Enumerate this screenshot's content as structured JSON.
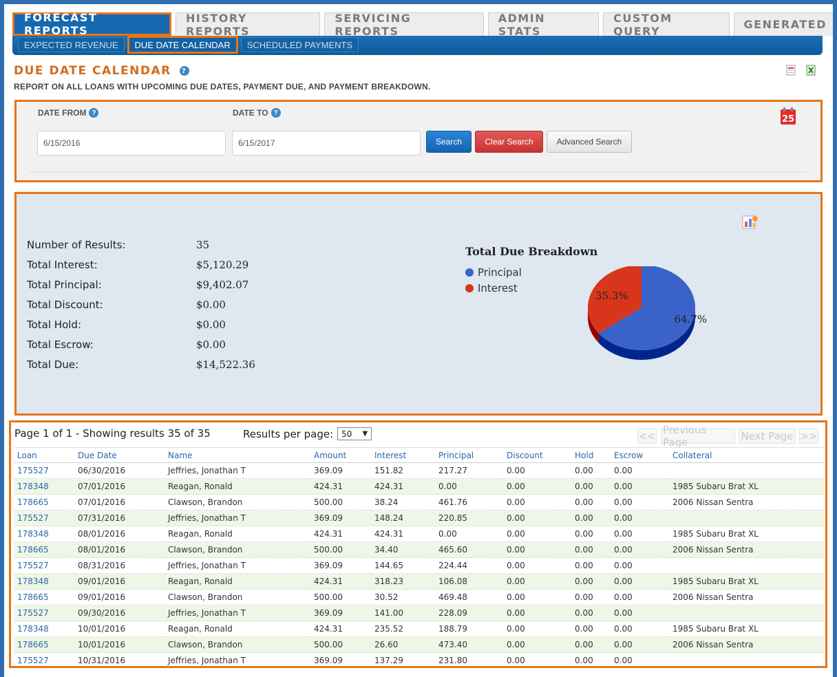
{
  "top_tabs": [
    {
      "label": "FORECAST REPORTS",
      "active": true
    },
    {
      "label": "HISTORY REPORTS",
      "active": false
    },
    {
      "label": "SERVICING REPORTS",
      "active": false
    },
    {
      "label": "ADMIN STATS",
      "active": false
    },
    {
      "label": "CUSTOM QUERY",
      "active": false
    },
    {
      "label": "GENERATED",
      "active": false
    }
  ],
  "sub_tabs": [
    {
      "label": "EXPECTED REVENUE",
      "active": false
    },
    {
      "label": "DUE DATE CALENDAR",
      "active": true
    },
    {
      "label": "SCHEDULED PAYMENTS",
      "active": false
    }
  ],
  "page": {
    "title": "DUE DATE CALENDAR",
    "description": "REPORT ON ALL LOANS WITH UPCOMING DUE DATES, PAYMENT DUE, AND PAYMENT BREAKDOWN."
  },
  "search": {
    "date_from_label": "DATE FROM",
    "date_from_value": "6/15/2016",
    "date_to_label": "DATE TO",
    "date_to_value": "6/15/2017",
    "search_label": "Search",
    "clear_label": "Clear Search",
    "advanced_label": "Advanced Search",
    "calendar_day": "25"
  },
  "summary": {
    "rows": [
      {
        "label": "Number of Results:",
        "value": "35"
      },
      {
        "label": "Total Interest:",
        "value": "$5,120.29"
      },
      {
        "label": "Total Principal:",
        "value": "$9,402.07"
      },
      {
        "label": "Total Discount:",
        "value": "$0.00"
      },
      {
        "label": "Total Hold:",
        "value": "$0.00"
      },
      {
        "label": "Total Escrow:",
        "value": "$0.00"
      },
      {
        "label": "Total Due:",
        "value": "$14,522.36"
      }
    ]
  },
  "chart_data": {
    "type": "pie",
    "title": "Total Due Breakdown",
    "categories": [
      "Principal",
      "Interest"
    ],
    "values": [
      64.7,
      35.3
    ],
    "labels": [
      "64.7%",
      "35.3%"
    ],
    "colors": [
      "#3a62c9",
      "#d8361c"
    ],
    "legend": "top-left"
  },
  "results": {
    "page_info": "Page 1 of 1 - Showing results 35 of 35",
    "per_page_label": "Results per page:",
    "per_page_value": "50",
    "first_label": "<<",
    "prev_label": "Previous Page",
    "next_label": "Next Page",
    "last_label": ">>",
    "columns": [
      "Loan",
      "Due Date",
      "Name",
      "Amount",
      "Interest",
      "Principal",
      "Discount",
      "Hold",
      "Escrow",
      "Collateral"
    ],
    "rows": [
      [
        "175527",
        "06/30/2016",
        "Jeffries, Jonathan T",
        "369.09",
        "151.82",
        "217.27",
        "0.00",
        "0.00",
        "0.00",
        ""
      ],
      [
        "178348",
        "07/01/2016",
        "Reagan, Ronald",
        "424.31",
        "424.31",
        "0.00",
        "0.00",
        "0.00",
        "0.00",
        "1985 Subaru Brat XL"
      ],
      [
        "178665",
        "07/01/2016",
        "Clawson, Brandon",
        "500.00",
        "38.24",
        "461.76",
        "0.00",
        "0.00",
        "0.00",
        "2006 Nissan Sentra"
      ],
      [
        "175527",
        "07/31/2016",
        "Jeffries, Jonathan T",
        "369.09",
        "148.24",
        "220.85",
        "0.00",
        "0.00",
        "0.00",
        ""
      ],
      [
        "178348",
        "08/01/2016",
        "Reagan, Ronald",
        "424.31",
        "424.31",
        "0.00",
        "0.00",
        "0.00",
        "0.00",
        "1985 Subaru Brat XL"
      ],
      [
        "178665",
        "08/01/2016",
        "Clawson, Brandon",
        "500.00",
        "34.40",
        "465.60",
        "0.00",
        "0.00",
        "0.00",
        "2006 Nissan Sentra"
      ],
      [
        "175527",
        "08/31/2016",
        "Jeffries, Jonathan T",
        "369.09",
        "144.65",
        "224.44",
        "0.00",
        "0.00",
        "0.00",
        ""
      ],
      [
        "178348",
        "09/01/2016",
        "Reagan, Ronald",
        "424.31",
        "318.23",
        "106.08",
        "0.00",
        "0.00",
        "0.00",
        "1985 Subaru Brat XL"
      ],
      [
        "178665",
        "09/01/2016",
        "Clawson, Brandon",
        "500.00",
        "30.52",
        "469.48",
        "0.00",
        "0.00",
        "0.00",
        "2006 Nissan Sentra"
      ],
      [
        "175527",
        "09/30/2016",
        "Jeffries, Jonathan T",
        "369.09",
        "141.00",
        "228.09",
        "0.00",
        "0.00",
        "0.00",
        ""
      ],
      [
        "178348",
        "10/01/2016",
        "Reagan, Ronald",
        "424.31",
        "235.52",
        "188.79",
        "0.00",
        "0.00",
        "0.00",
        "1985 Subaru Brat XL"
      ],
      [
        "178665",
        "10/01/2016",
        "Clawson, Brandon",
        "500.00",
        "26.60",
        "473.40",
        "0.00",
        "0.00",
        "0.00",
        "2006 Nissan Sentra"
      ],
      [
        "175527",
        "10/31/2016",
        "Jeffries, Jonathan T",
        "369.09",
        "137.29",
        "231.80",
        "0.00",
        "0.00",
        "0.00",
        ""
      ]
    ]
  }
}
